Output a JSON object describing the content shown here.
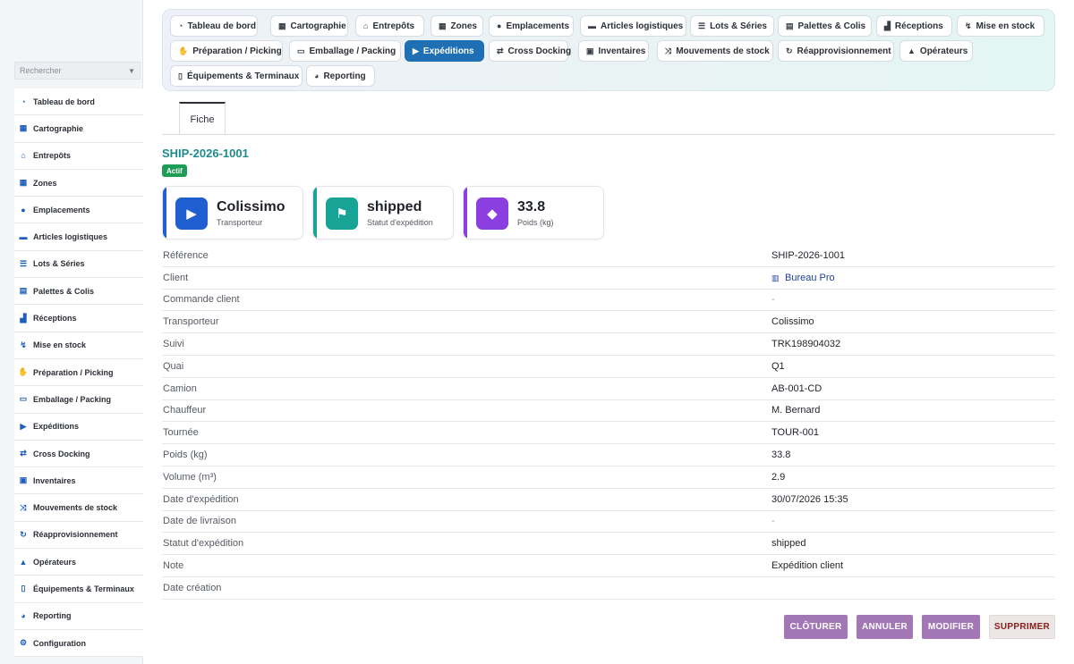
{
  "sidebar": {
    "search_placeholder": "Rechercher",
    "items": [
      {
        "label": "Tableau de bord",
        "icon": "dashboard-icon"
      },
      {
        "label": "Cartographie",
        "icon": "map-icon"
      },
      {
        "label": "Entrepôts",
        "icon": "warehouse-icon"
      },
      {
        "label": "Zones",
        "icon": "grid-icon"
      },
      {
        "label": "Emplacements",
        "icon": "map-pin-icon"
      },
      {
        "label": "Articles logistiques",
        "icon": "box-icon"
      },
      {
        "label": "Lots & Séries",
        "icon": "list-icon"
      },
      {
        "label": "Palettes & Colis",
        "icon": "pallet-icon"
      },
      {
        "label": "Réceptions",
        "icon": "truck-loading-icon"
      },
      {
        "label": "Mise en stock",
        "icon": "dolly-icon"
      },
      {
        "label": "Préparation / Picking",
        "icon": "hand-icon"
      },
      {
        "label": "Emballage / Packing",
        "icon": "package-icon"
      },
      {
        "label": "Expéditions",
        "icon": "truck-icon"
      },
      {
        "label": "Cross Docking",
        "icon": "exchange-icon"
      },
      {
        "label": "Inventaires",
        "icon": "clipboard-icon"
      },
      {
        "label": "Mouvements de stock",
        "icon": "shuffle-icon"
      },
      {
        "label": "Réapprovisionnement",
        "icon": "refresh-icon"
      },
      {
        "label": "Opérateurs",
        "icon": "hard-hat-icon"
      },
      {
        "label": "Équipements & Terminaux",
        "icon": "mobile-icon"
      },
      {
        "label": "Reporting",
        "icon": "pie-chart-icon"
      },
      {
        "label": "Configuration",
        "icon": "gear-icon"
      }
    ]
  },
  "module_tabs": [
    {
      "label": "Tableau de bord",
      "icon": "dashboard-icon"
    },
    {
      "label": "Cartographie",
      "icon": "map-icon"
    },
    {
      "label": "Entrepôts",
      "icon": "warehouse-icon"
    },
    {
      "label": "Zones",
      "icon": "grid-icon"
    },
    {
      "label": "Emplacements",
      "icon": "map-pin-icon"
    },
    {
      "label": "Articles logistiques",
      "icon": "box-icon"
    },
    {
      "label": "Lots & Séries",
      "icon": "list-icon"
    },
    {
      "label": "Palettes & Colis",
      "icon": "pallet-icon"
    },
    {
      "label": "Réceptions",
      "icon": "truck-loading-icon"
    },
    {
      "label": "Mise en stock",
      "icon": "dolly-icon"
    },
    {
      "label": "Préparation / Picking",
      "icon": "hand-icon"
    },
    {
      "label": "Emballage / Packing",
      "icon": "package-icon"
    },
    {
      "label": "Expéditions",
      "icon": "truck-icon",
      "active": true
    },
    {
      "label": "Cross Docking",
      "icon": "exchange-icon"
    },
    {
      "label": "Inventaires",
      "icon": "clipboard-icon"
    },
    {
      "label": "Mouvements de stock",
      "icon": "shuffle-icon"
    },
    {
      "label": "Réapprovisionnement",
      "icon": "refresh-icon"
    },
    {
      "label": "Opérateurs",
      "icon": "hard-hat-icon"
    },
    {
      "label": "Équipements & Terminaux",
      "icon": "mobile-icon"
    },
    {
      "label": "Reporting",
      "icon": "pie-chart-icon"
    }
  ],
  "record": {
    "tab": "Fiche",
    "title": "SHIP-2026-1001",
    "status_badge": "Actif",
    "status_badge_color": "#1f9d57"
  },
  "kpis": [
    {
      "value": "Colissimo",
      "label": "Transporteur",
      "icon": "truck-icon",
      "color": "#1f5fd1"
    },
    {
      "value": "shipped",
      "label": "Statut d'expédition",
      "icon": "flag-icon",
      "color": "#17a395"
    },
    {
      "value": "33.8",
      "label": "Poids (kg)",
      "icon": "weight-icon",
      "color": "#8b3fe0"
    }
  ],
  "fields": [
    {
      "key": "Référence",
      "value": "SHIP-2026-1001"
    },
    {
      "key": "Client",
      "value": "Bureau Pro",
      "link": true,
      "icon": "building-icon"
    },
    {
      "key": "Commande client",
      "value": "-"
    },
    {
      "key": "Transporteur",
      "value": "Colissimo"
    },
    {
      "key": "Suivi",
      "value": "TRK198904032"
    },
    {
      "key": "Quai",
      "value": "Q1"
    },
    {
      "key": "Camion",
      "value": "AB-001-CD"
    },
    {
      "key": "Chauffeur",
      "value": "M. Bernard"
    },
    {
      "key": "Tournée",
      "value": "TOUR-001"
    },
    {
      "key": "Poids (kg)",
      "value": "33.8"
    },
    {
      "key": "Volume (m³)",
      "value": "2.9"
    },
    {
      "key": "Date d'expédition",
      "value": "30/07/2026 15:35"
    },
    {
      "key": "Date de livraison",
      "value": "-"
    },
    {
      "key": "Statut d'expédition",
      "value": "shipped"
    },
    {
      "key": "Note",
      "value": "Expédition client"
    },
    {
      "key": "Date création",
      "value": ""
    }
  ],
  "actions": {
    "close_label": "CLÔTURER",
    "cancel_label": "ANNULER",
    "edit_label": "MODIFIER",
    "delete_label": "SUPPRIMER"
  }
}
